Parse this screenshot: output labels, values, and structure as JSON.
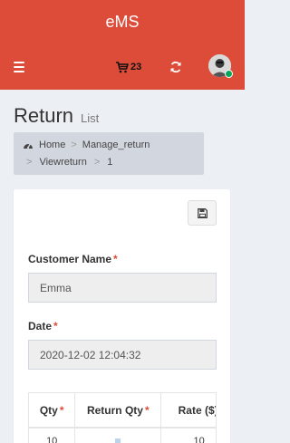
{
  "app": {
    "title": "eMS"
  },
  "navbar": {
    "cart_count": "23",
    "icons": {
      "menu": "menu-icon",
      "cart": "cart-icon",
      "refresh": "refresh-icon",
      "avatar": "user-avatar"
    },
    "brand_color": "#dd4b39",
    "online_color": "#00a65a"
  },
  "header": {
    "title": "Return",
    "subtitle": "List"
  },
  "breadcrumb": {
    "items": [
      "Home",
      "Manage_return",
      "Viewreturn",
      "1"
    ]
  },
  "form": {
    "customer_name": {
      "label": "Customer Name",
      "required": "*",
      "value": "Emma"
    },
    "date": {
      "label": "Date",
      "required": "*",
      "value": "2020-12-02 12:04:32"
    }
  },
  "table": {
    "columns": [
      {
        "label": "Qty",
        "required": "*"
      },
      {
        "label": "Return Qty",
        "required": "*"
      },
      {
        "label": "Rate ($)",
        "required": ""
      }
    ],
    "rows": [
      [
        "10",
        "",
        "10"
      ]
    ]
  }
}
